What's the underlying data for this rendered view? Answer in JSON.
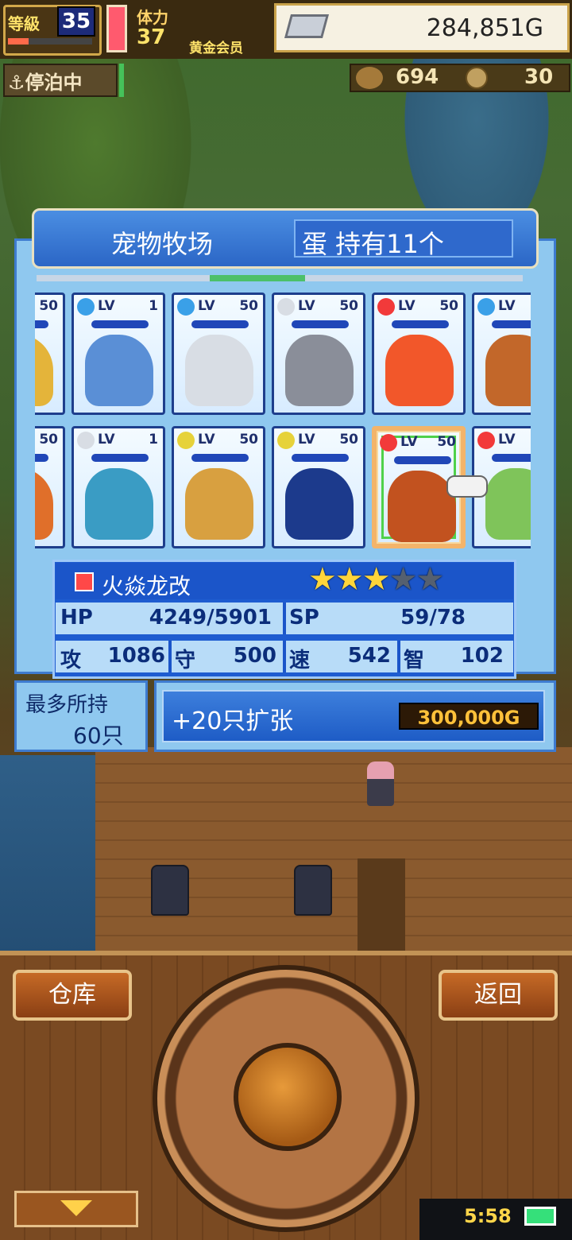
{
  "hud": {
    "level_label": "等級",
    "level": "35",
    "stamina_label": "体力",
    "stamina": "37",
    "membership": "黄金会员",
    "gold": "284,851G",
    "anchor_status": "停泊中",
    "resource_1": "694",
    "resource_2": "30"
  },
  "panel": {
    "title": "宠物牧场",
    "eggs": "蛋 持有11个"
  },
  "cards": [
    {
      "element": "partial",
      "level": "50",
      "color": "#e4b43a"
    },
    {
      "element": "water",
      "level": "1",
      "color": "#5a8fd6"
    },
    {
      "element": "water",
      "level": "50",
      "color": "#d8dde4"
    },
    {
      "element": "neutral",
      "level": "50",
      "color": "#8a8e99"
    },
    {
      "element": "fire",
      "level": "50",
      "color": "#f2572a"
    },
    {
      "element": "water",
      "level": "",
      "color": "#c2672a"
    },
    {
      "element": "partial",
      "level": "50",
      "color": "#e06f2a"
    },
    {
      "element": "neutral",
      "level": "1",
      "color": "#3a9cc4"
    },
    {
      "element": "thunder",
      "level": "50",
      "color": "#d8a040"
    },
    {
      "element": "thunder",
      "level": "50",
      "color": "#1c3a8c"
    },
    {
      "element": "fire",
      "level": "50",
      "color": "#c2521f"
    },
    {
      "element": "fire",
      "level": "",
      "color": "#7fc45a"
    }
  ],
  "lv_label": "LV",
  "element_colors": {
    "water": "#3aa0e8",
    "fire": "#f23a3a",
    "thunder": "#e6d23a",
    "neutral": "#d8dde4",
    "partial": "#3aa0e8"
  },
  "selected": {
    "name": "火焱龙改",
    "stars": 3,
    "stars_total": 5,
    "hp_label": "HP",
    "hp": "4249/5901",
    "sp_label": "SP",
    "sp": "59/78",
    "atk_label": "攻",
    "atk": "1086",
    "def_label": "守",
    "def": "500",
    "spd_label": "速",
    "spd": "542",
    "int_label": "智",
    "int": "102"
  },
  "capacity": {
    "label": "最多所持",
    "value": "60只"
  },
  "expand": {
    "label": "+20只扩张",
    "cost": "300,000G"
  },
  "buttons": {
    "warehouse": "仓库",
    "back": "返回"
  },
  "status": {
    "time": "5:58"
  }
}
